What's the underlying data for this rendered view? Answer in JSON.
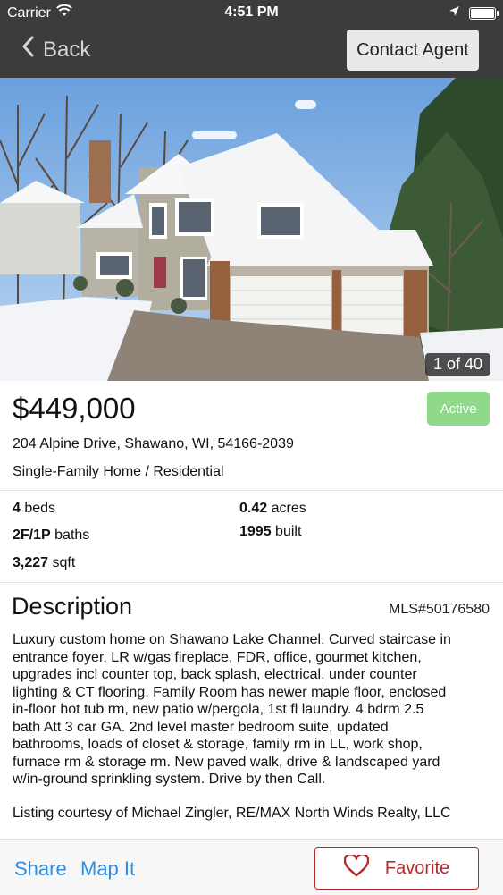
{
  "status_bar": {
    "carrier": "Carrier",
    "time": "4:51 PM"
  },
  "nav": {
    "back_label": "Back",
    "contact_label": "Contact Agent"
  },
  "hero": {
    "photo_counter": "1 of 40"
  },
  "listing": {
    "price": "$449,000",
    "status": "Active",
    "address": "204 Alpine Drive, Shawano, WI, 54166-2039",
    "property_type": "Single-Family Home / Residential"
  },
  "specs": {
    "beds_value": "4",
    "beds_label": "beds",
    "baths_value": "2F/1P",
    "baths_label": "baths",
    "sqft_value": "3,227",
    "sqft_label": "sqft",
    "acres_value": "0.42",
    "acres_label": "acres",
    "built_value": "1995",
    "built_label": "built"
  },
  "description": {
    "title": "Description",
    "mls": "MLS#50176580",
    "lines": [
      "Luxury custom home on Shawano Lake Channel. Curved staircase in",
      "entrance foyer, LR w/gas fireplace, FDR, office, gourmet kitchen,",
      "upgrades incl counter top, back splash, electrical, under counter",
      "lighting & CT flooring. Family Room has newer maple floor, enclosed",
      "in-floor hot tub rm, new patio w/pergola, 1st fl laundry. 4 bdrm 2.5",
      "bath Att 3 car GA. 2nd level master bedroom suite, updated",
      "bathrooms, loads of closet & storage, family rm in LL, work shop,",
      "furnace rm & storage rm. New paved walk, drive & landscaped yard",
      "w/in-ground sprinkling system. Drive by then Call."
    ],
    "courtesy": "Listing courtesy of Michael Zingler, RE/MAX North Winds Realty, LLC"
  },
  "bottom_bar": {
    "share_label": "Share",
    "map_label": "Map It",
    "favorite_label": "Favorite"
  },
  "colors": {
    "nav_bg": "#3c3c3c",
    "badge_green": "#8ed98a",
    "link_blue": "#2f8de4",
    "favorite_red": "#b52b2b"
  },
  "icons": [
    "wifi-icon",
    "location-arrow-icon",
    "battery-icon",
    "chevron-left-icon",
    "heart-icon"
  ]
}
